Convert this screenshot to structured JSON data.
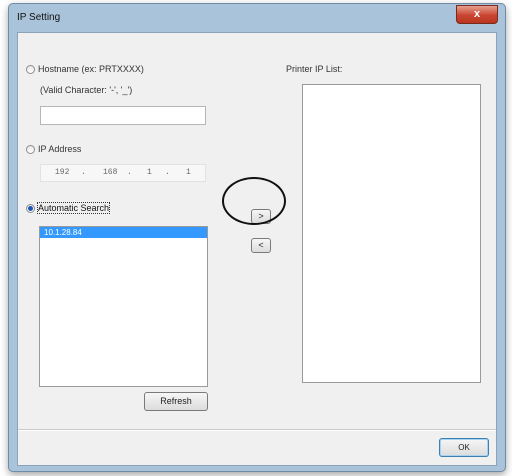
{
  "window": {
    "title": "IP Setting",
    "close_glyph": "x"
  },
  "hostname": {
    "label": "Hostname (ex: PRTXXXX)",
    "hint": "(Valid Character: '-', '_')",
    "value": ""
  },
  "ip_address": {
    "label": "IP Address",
    "octets": [
      "192",
      "168",
      "1",
      "1"
    ],
    "separator": "."
  },
  "auto_search": {
    "label": "Automatic Search",
    "results": [
      "10.1.28.84"
    ]
  },
  "buttons": {
    "add": ">",
    "remove": "<",
    "refresh": "Refresh",
    "ok": "OK"
  },
  "printer_list": {
    "label": "Printer IP List:",
    "items": []
  },
  "colors": {
    "selection": "#3399ff",
    "titlebar": "#a9c3da",
    "close": "#c94532",
    "dialog_bg": "#f0f0f0"
  }
}
